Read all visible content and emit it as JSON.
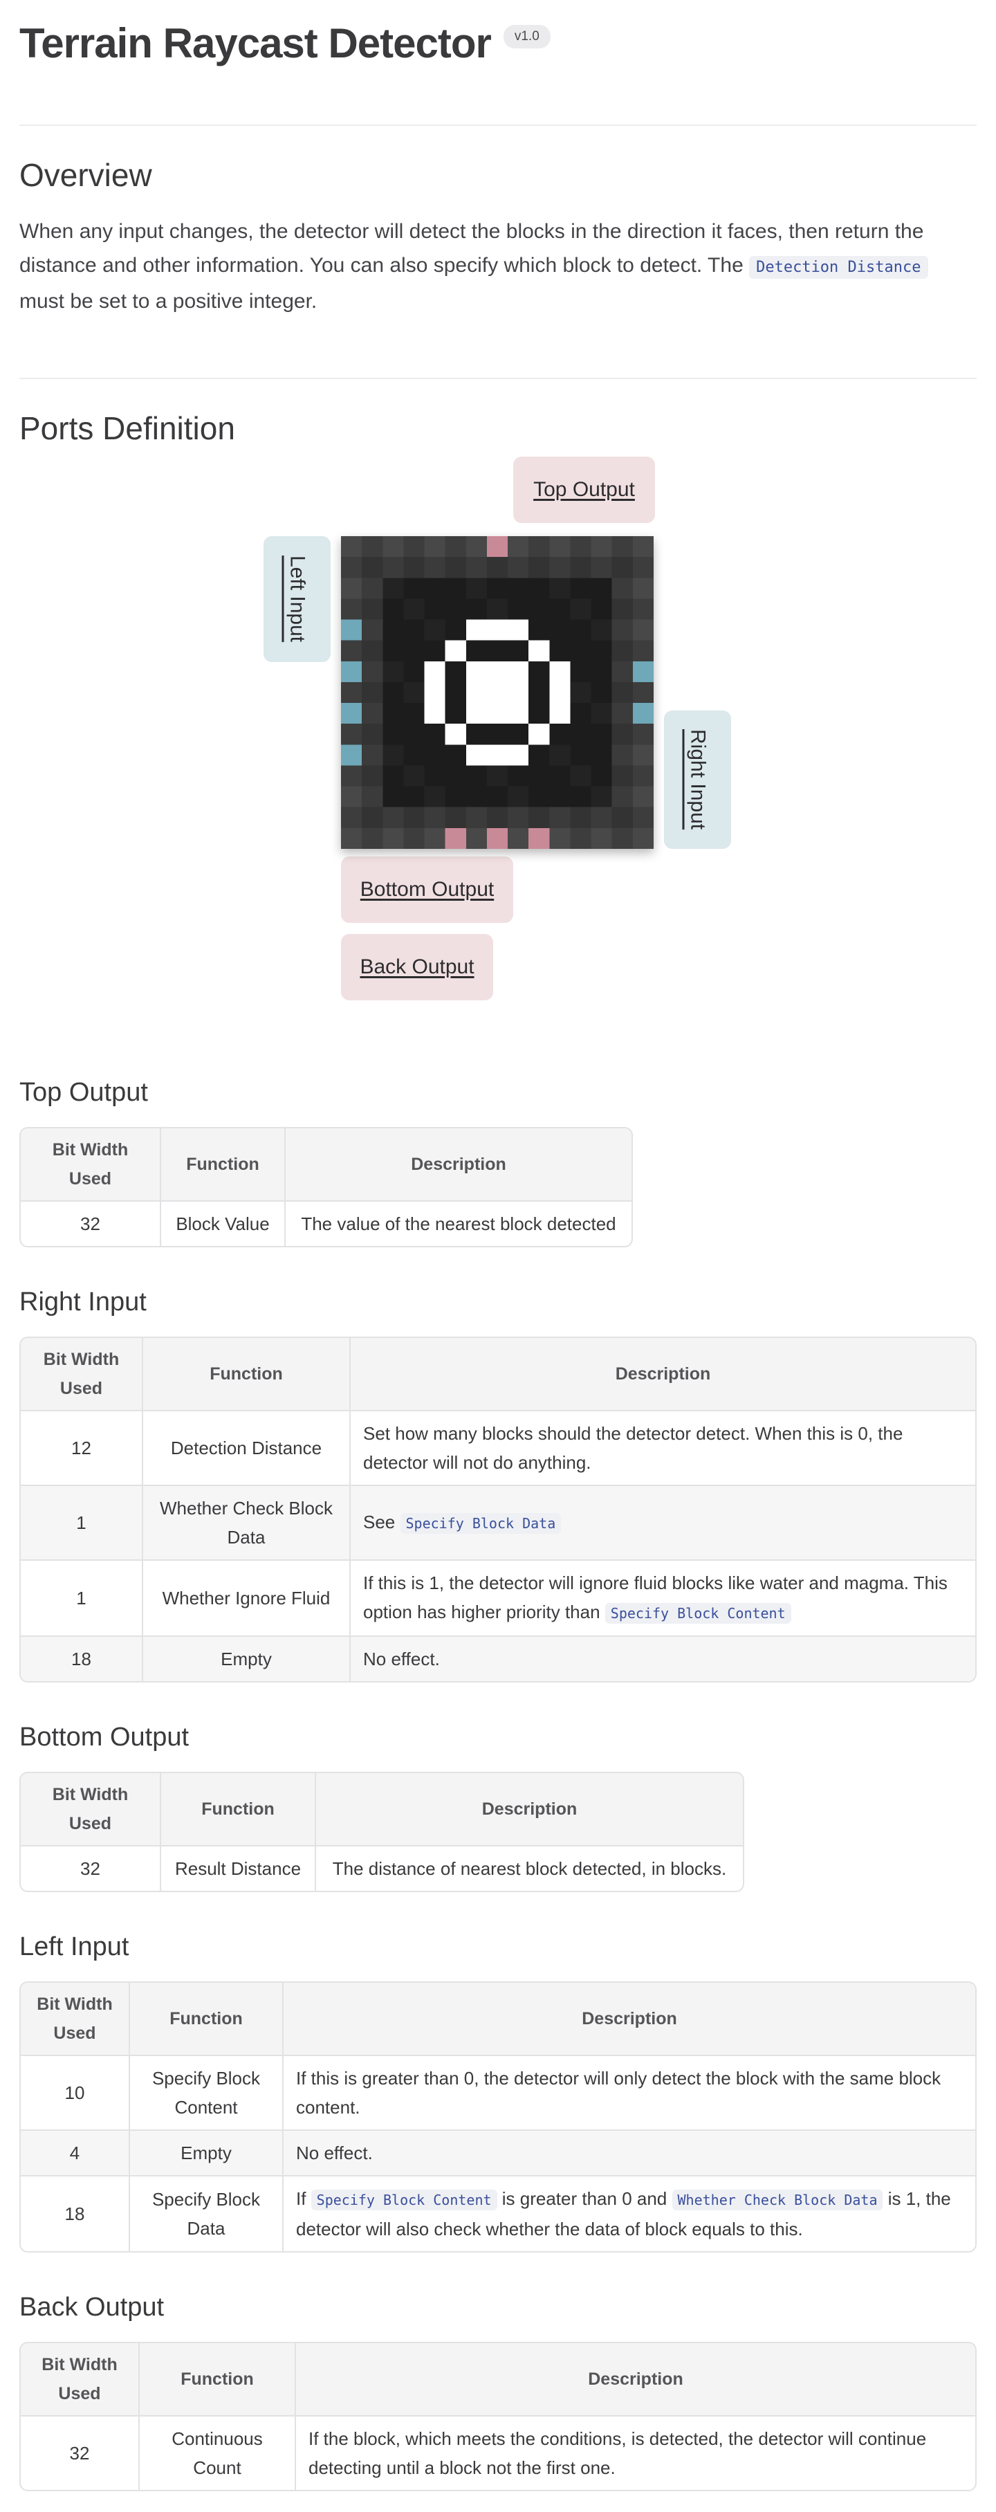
{
  "header": {
    "title": "Terrain Raycast Detector",
    "version": "v1.0"
  },
  "overview": {
    "heading": "Overview",
    "text_before": "When any input changes, the detector will detect the blocks in the direction it faces, then return the distance and other information. You can also specify which block to detect. The ",
    "code": "Detection Distance",
    "text_after": " must be set to a positive integer."
  },
  "ports": {
    "heading": "Ports Definition",
    "labels": {
      "top_output": "Top Output",
      "left_input": "Left Input",
      "right_input": "Right Input",
      "bottom_output": "Bottom Output",
      "back_output": "Back Output"
    },
    "colors": {
      "output": "#f1e0e2",
      "input": "#dbe8ec",
      "port_out": "#c98a97",
      "port_in": "#6fa8b8"
    }
  },
  "table_headers": {
    "bit_width": "Bit Width Used",
    "function": "Function",
    "description": "Description"
  },
  "top_output": {
    "title": "Top Output",
    "rows": [
      {
        "bits": "32",
        "function": "Block Value",
        "description": "The value of the nearest block detected"
      }
    ]
  },
  "right_input": {
    "title": "Right Input",
    "rows": [
      {
        "bits": "12",
        "function": "Detection Distance",
        "description": "Set how many blocks should the detector detect. When this is 0, the detector will not do anything."
      },
      {
        "bits": "1",
        "function": "Whether Check Block Data",
        "desc_prefix": "See ",
        "desc_code": "Specify Block Data"
      },
      {
        "bits": "1",
        "function": "Whether Ignore Fluid",
        "desc_prefix": "If this is 1, the detector will ignore fluid blocks like water and magma. This option has higher priority than ",
        "desc_code": "Specify Block Content"
      },
      {
        "bits": "18",
        "function": "Empty",
        "description": "No effect."
      }
    ]
  },
  "bottom_output": {
    "title": "Bottom Output",
    "rows": [
      {
        "bits": "32",
        "function": "Result Distance",
        "description": "The distance of nearest block detected, in blocks."
      }
    ]
  },
  "left_input": {
    "title": "Left Input",
    "rows": [
      {
        "bits": "10",
        "function": "Specify Block Content",
        "description": "If this is greater than 0, the detector will only detect the block with the same block content."
      },
      {
        "bits": "4",
        "function": "Empty",
        "description": "No effect."
      },
      {
        "bits": "18",
        "function": "Specify Block Data",
        "desc_prefix": "If ",
        "desc_code": "Specify Block Content",
        "desc_mid": " is greater than 0 and ",
        "desc_code2": "Whether Check Block Data",
        "desc_suffix": " is 1, the detector will also check whether the data of block equals to this."
      }
    ]
  },
  "back_output": {
    "title": "Back Output",
    "rows": [
      {
        "bits": "32",
        "function": "Continuous Count",
        "description": "If the block, which meets the conditions, is detected, the detector will continue detecting until a block not the first one."
      }
    ]
  }
}
